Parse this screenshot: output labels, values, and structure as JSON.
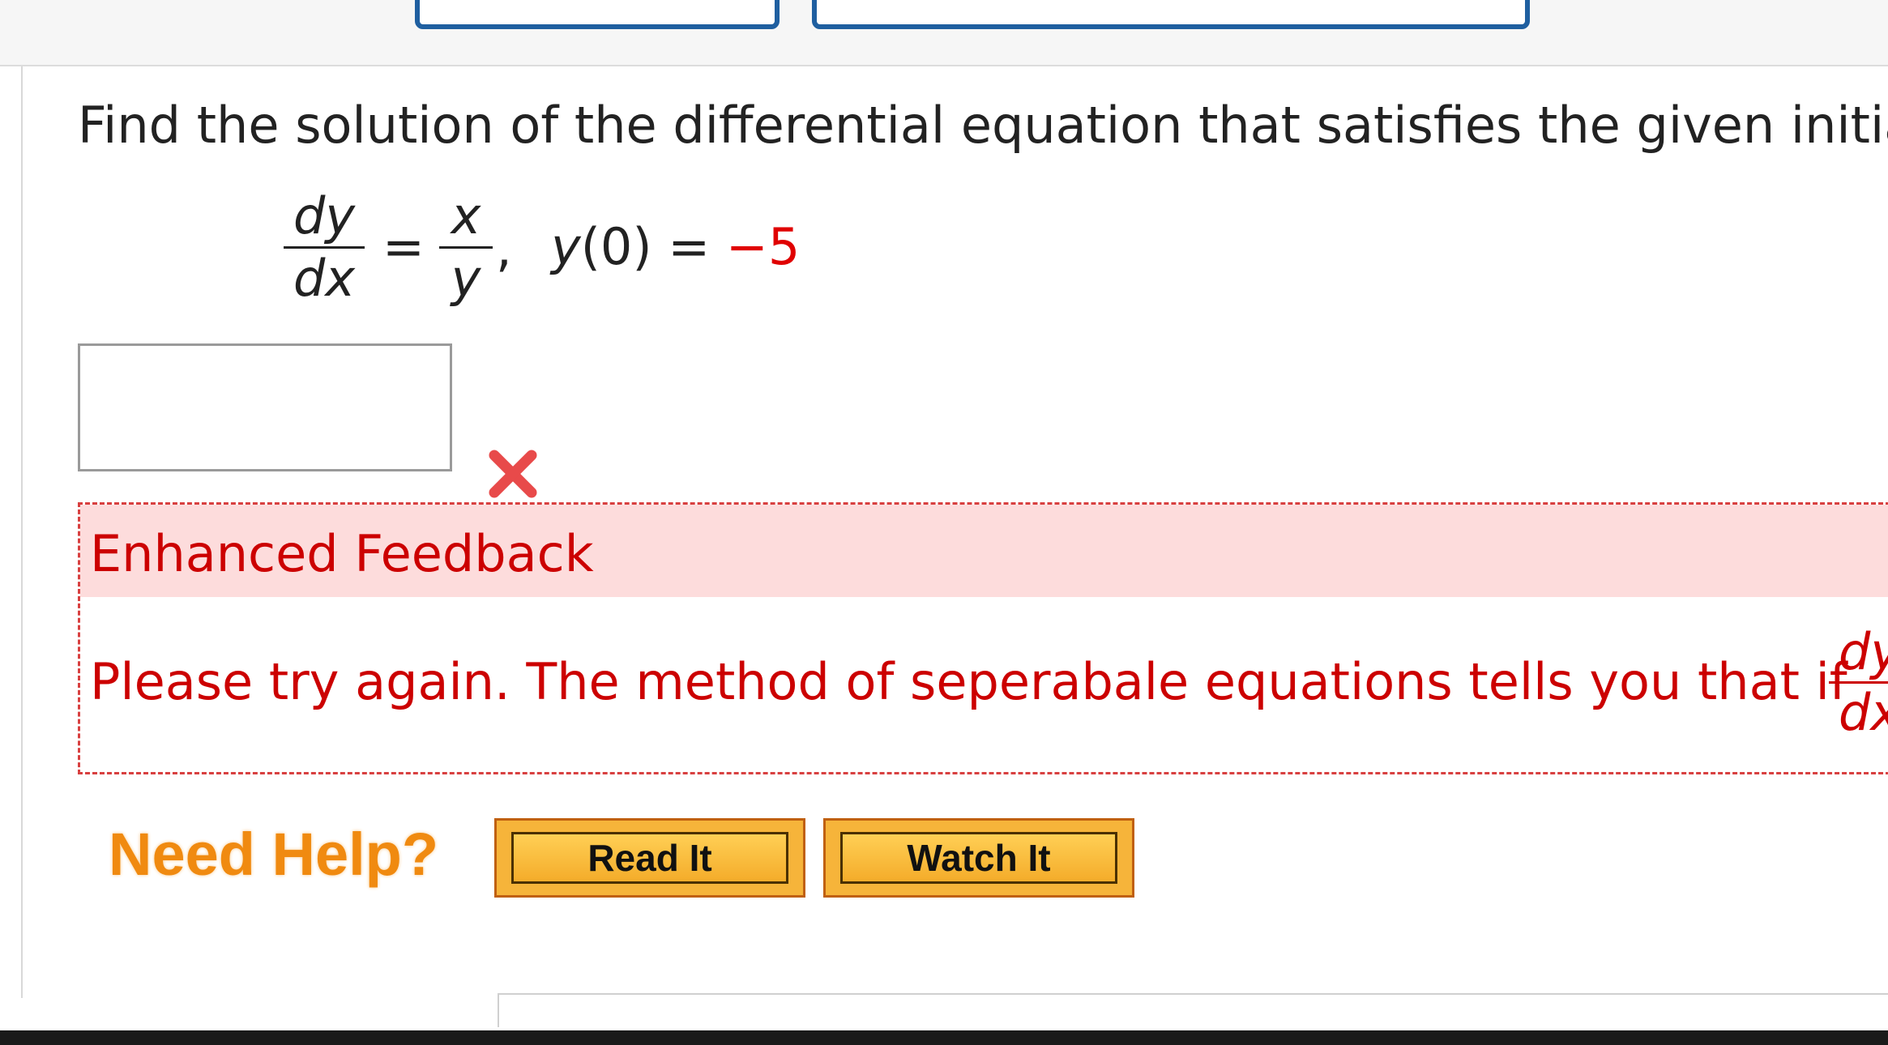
{
  "question": {
    "prompt": "Find the solution of the differential equation that satisfies the given initial",
    "equation": {
      "lhs_num": "dy",
      "lhs_den": "dx",
      "equals": "=",
      "rhs_num": "x",
      "rhs_den": "y",
      "separator": ",",
      "initial_fn": "y",
      "initial_arg": "(0)",
      "initial_equals": " = ",
      "initial_value": "−5"
    },
    "answer": {
      "value": "",
      "placeholder": ""
    },
    "status_icon": "wrong-x-icon"
  },
  "feedback": {
    "title": "Enhanced Feedback",
    "message": "Please try again. The method of seperabale equations tells you that if",
    "frac_num": "dy",
    "frac_den": "dx"
  },
  "help": {
    "label": "Need Help?",
    "read_label": "Read It",
    "watch_label": "Watch It"
  },
  "colors": {
    "accent_blue": "#1f5fa0",
    "error_red": "#cc0000",
    "feedback_bg": "#fddcdc",
    "help_orange": "#f08a10",
    "button_gold": "#f6b43a"
  }
}
